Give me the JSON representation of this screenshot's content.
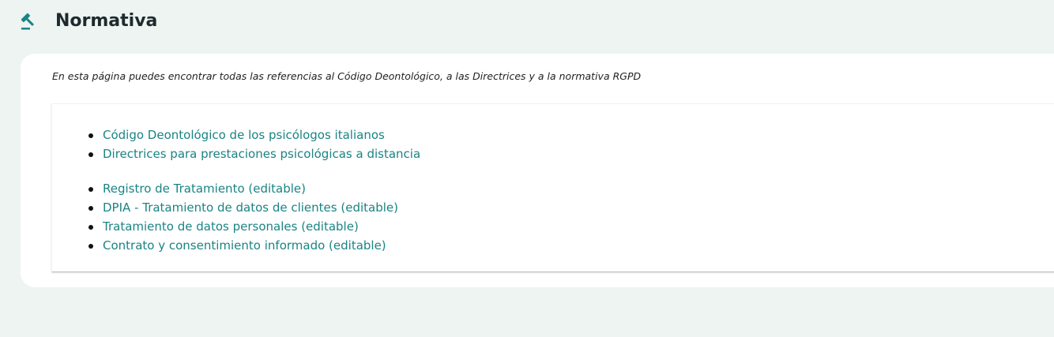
{
  "header": {
    "icon": "gavel-icon",
    "title": "Normativa"
  },
  "intro": "En esta página puedes encontrar todas las referencias al Código Deontológico, a las Directrices y a la normativa RGPD",
  "links_group_1": [
    {
      "label": "Código Deontológico de los psicólogos italianos"
    },
    {
      "label": "Directrices para prestaciones psicológicas a distancia"
    }
  ],
  "links_group_2": [
    {
      "label": "Registro de Tratamiento (editable)"
    },
    {
      "label": "DPIA - Tratamiento de datos de clientes (editable)"
    },
    {
      "label": "Tratamiento de datos personales (editable)"
    },
    {
      "label": "Contrato y consentimiento informado (editable)"
    }
  ],
  "colors": {
    "background": "#edf4f1",
    "accent": "#1a8483",
    "text": "#1f2a2d"
  }
}
